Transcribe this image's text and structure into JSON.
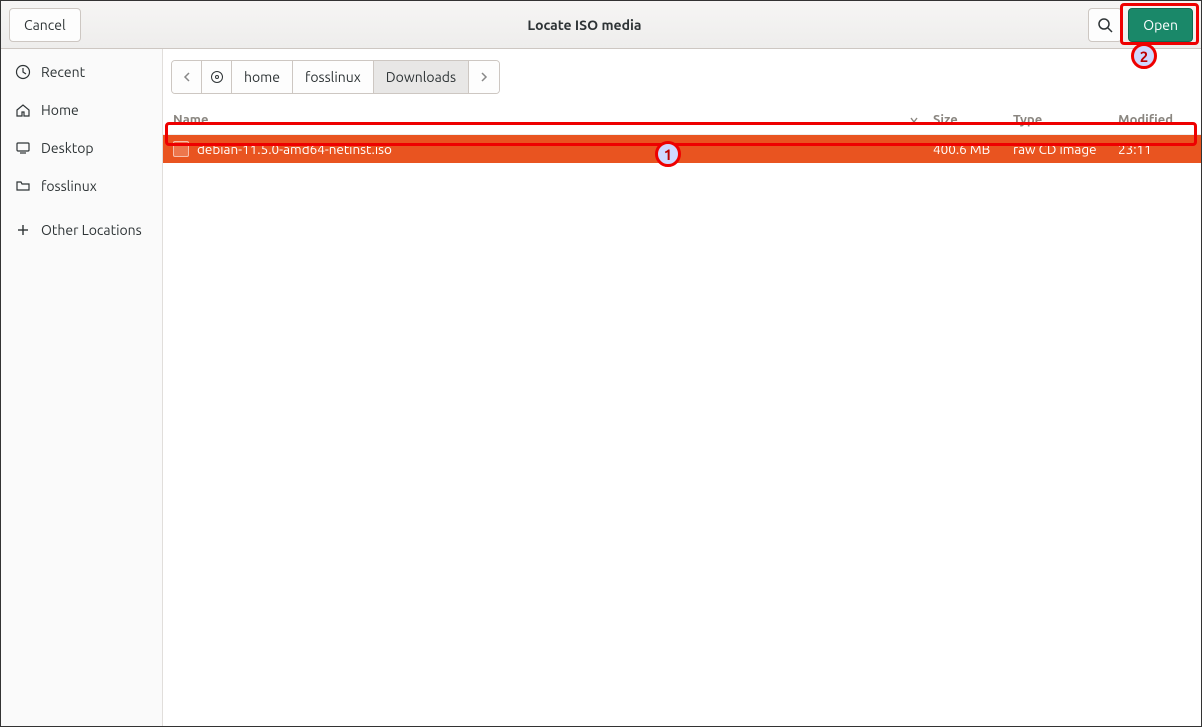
{
  "header": {
    "cancel": "Cancel",
    "title": "Locate ISO media",
    "open": "Open"
  },
  "sidebar": {
    "items": [
      {
        "label": "Recent",
        "icon": "clock"
      },
      {
        "label": "Home",
        "icon": "home"
      },
      {
        "label": "Desktop",
        "icon": "desktop"
      },
      {
        "label": "fosslinux",
        "icon": "folder"
      },
      {
        "label": "Other Locations",
        "icon": "plus"
      }
    ]
  },
  "path": {
    "segments": [
      "home",
      "fosslinux",
      "Downloads"
    ]
  },
  "columns": {
    "name": "Name",
    "size": "Size",
    "type": "Type",
    "modified": "Modified"
  },
  "files": [
    {
      "name": "debian-11.5.0-amd64-netinst.iso",
      "size": "400.6 MB",
      "type": "raw CD image",
      "modified": "23:11"
    }
  ],
  "annotations": {
    "one": "1",
    "two": "2"
  }
}
